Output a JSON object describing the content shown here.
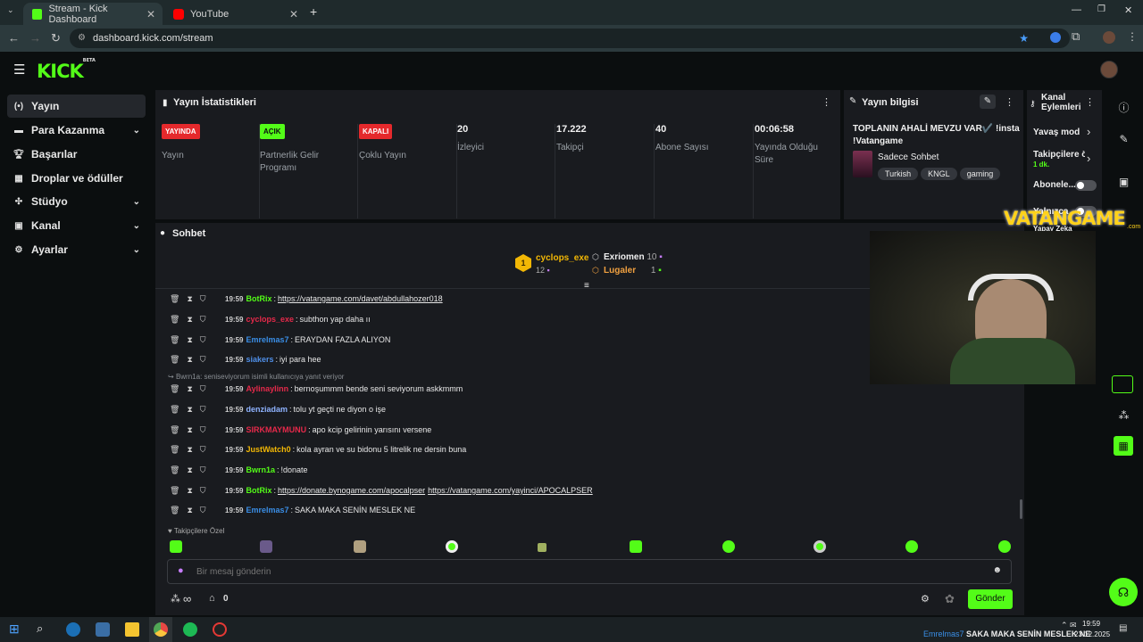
{
  "browser": {
    "tabs": [
      {
        "title": "Stream - Kick Dashboard",
        "active": true
      },
      {
        "title": "YouTube",
        "active": false
      }
    ],
    "url": "dashboard.kick.com/stream"
  },
  "logo": {
    "text": "KICK",
    "beta": "BETA"
  },
  "sidebar": {
    "items": [
      {
        "label": "Yayın",
        "icon": "broadcast-icon",
        "active": true
      },
      {
        "label": "Para Kazanma",
        "icon": "money-icon",
        "expandable": true
      },
      {
        "label": "Başarılar",
        "icon": "trophy-icon"
      },
      {
        "label": "Droplar ve ödüller",
        "icon": "gift-icon"
      },
      {
        "label": "Stüdyo",
        "icon": "studio-icon",
        "expandable": true
      },
      {
        "label": "Kanal",
        "icon": "channel-icon",
        "expandable": true
      },
      {
        "label": "Ayarlar",
        "icon": "gear-icon",
        "expandable": true
      }
    ]
  },
  "stats": {
    "title": "Yayın İstatistikleri",
    "items": [
      {
        "badge": "YAYINDA",
        "badge_color": "#e5292c",
        "label": "Yayın"
      },
      {
        "badge": "AÇIK",
        "badge_color": "#53fc18",
        "label": "Partnerlik Gelir Programı"
      },
      {
        "badge": "KAPALI",
        "badge_color": "#e5292c",
        "label": "Çoklu Yayın"
      },
      {
        "value": "20",
        "label": "İzleyici"
      },
      {
        "value": "17.222",
        "label": "Takipçi"
      },
      {
        "value": "40",
        "label": "Abone Sayısı"
      },
      {
        "value": "00:06:58",
        "label": "Yayında Olduğu Süre"
      }
    ]
  },
  "stream_info": {
    "title": "Yayın bilgisi",
    "stream_title": "TOPLANIN AHALİ MEVZU VAR✔️ !insta !Vatangame",
    "category": "Sadece Sohbet",
    "tags": [
      "Turkish",
      "KNGL",
      "gaming"
    ]
  },
  "channel_actions": {
    "title": "Kanal Eylemleri",
    "items": [
      {
        "label": "Yavaş mod"
      },
      {
        "label": "Takipçilere ö",
        "sub": "1 dk."
      },
      {
        "label": "Abonele..."
      },
      {
        "label": "Yalnızca",
        "sub": "Yapay Zeka"
      }
    ]
  },
  "chat": {
    "title": "Sohbet",
    "leaderboard": [
      {
        "rank": "1",
        "name": "cyclops_exe",
        "count": "12"
      },
      {
        "name": "Exriomen",
        "count": "10"
      },
      {
        "name": "Lugaler",
        "count": "1"
      }
    ],
    "reply_note": "Bwrn1a: seniseviyorum isimli kullanıcıya yanıt veriyor",
    "messages": [
      {
        "time": "19:59",
        "user": "BotRix",
        "user_color": "#53fc18",
        "text": "",
        "links": [
          "https://vatangame.com/davet/abdullahozer018"
        ]
      },
      {
        "time": "19:59",
        "user": "cyclops_exe",
        "user_color": "#e5294a",
        "text": "subthon yap daha ıı",
        "links": []
      },
      {
        "time": "19:59",
        "user": "Emrelmas7",
        "user_color": "#3a8ee6",
        "text": "ERAYDAN FAZLA ALIYON",
        "links": []
      },
      {
        "time": "19:59",
        "user": "siakers",
        "user_color": "#4f8fe8",
        "text": "iyi para hee",
        "links": []
      },
      {
        "time": "19:59",
        "user": "Aylinaylinn",
        "user_color": "#e5294a",
        "text": "bernoşummm bende seni seviyorum askkmmm",
        "links": []
      },
      {
        "time": "19:59",
        "user": "denziadam",
        "user_color": "#8fb3ff",
        "text": "tolu yt geçti ne diyon o işe",
        "links": []
      },
      {
        "time": "19:59",
        "user": "SIRKMAYMUNU",
        "user_color": "#e5294a",
        "text": "apo kcip gelirinin yarısını versene",
        "links": []
      },
      {
        "time": "19:59",
        "user": "JustWatch0",
        "user_color": "#f2b705",
        "text": "kola ayran ve su bidonu 5 litrelik ne dersin buna",
        "links": []
      },
      {
        "time": "19:59",
        "user": "Bwrn1a",
        "user_color": "#53fc18",
        "text": "!donate",
        "links": []
      },
      {
        "time": "19:59",
        "user": "BotRix",
        "user_color": "#53fc18",
        "text": "",
        "links": [
          "https://donate.bynogame.com/apocalpser",
          "https://vatangame.com/yayinci/APOCALPSER"
        ]
      },
      {
        "time": "19:59",
        "user": "Emrelmas7",
        "user_color": "#3a8ee6",
        "text": "SAKA MAKA SENİN MESLEK NE",
        "links": []
      }
    ],
    "emote_section": "Takipçilere Özel",
    "input_placeholder": "Bir mesaj gönderin",
    "points": "∞",
    "store_count": "0",
    "send_label": "Gönder"
  },
  "overlay": {
    "brand": "VATANGAME",
    "brand_sub": ".com"
  },
  "ticker": {
    "user": "Emrelmas7",
    "text": "SAKA MAKA SENİN MESLEK NE"
  },
  "taskbar": {
    "time": "19:59",
    "date": "23.12.2025"
  },
  "colors": {
    "accent": "#53fc18",
    "panel": "#191b1f",
    "bg": "#0b0e0f"
  }
}
